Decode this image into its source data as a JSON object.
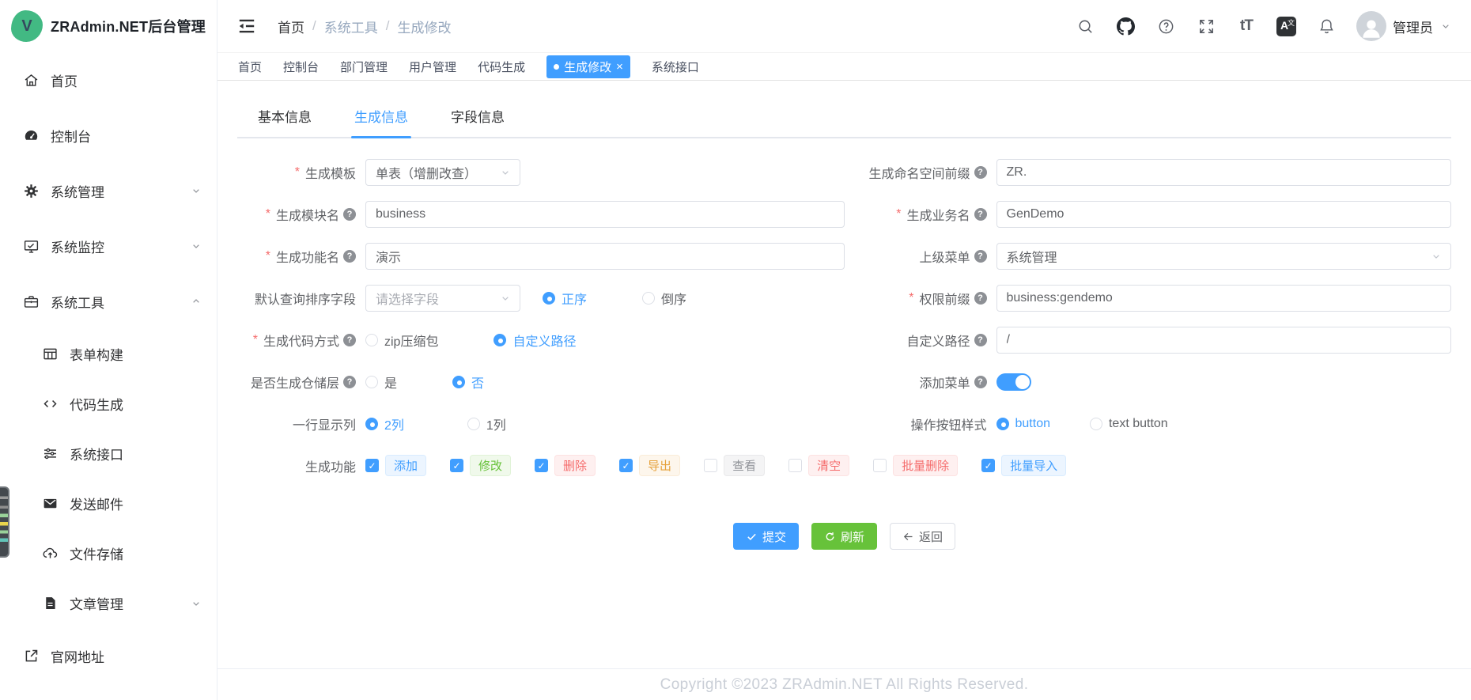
{
  "app": {
    "title": "ZRAdmin.NET后台管理",
    "logo_letter": "V"
  },
  "colors": {
    "primary": "#409eff",
    "success": "#67c23a",
    "danger": "#f56c6c",
    "warning": "#e6a23c",
    "info": "#909399",
    "logo_green": "#42b983"
  },
  "sidebar": {
    "items": [
      {
        "label": "首页",
        "icon": "home-icon"
      },
      {
        "label": "控制台",
        "icon": "dashboard-icon"
      },
      {
        "label": "系统管理",
        "icon": "gear-icon",
        "chevron": "down"
      },
      {
        "label": "系统监控",
        "icon": "monitor-icon",
        "chevron": "down"
      },
      {
        "label": "系统工具",
        "icon": "briefcase-icon",
        "chevron": "up",
        "expanded": true
      },
      {
        "label": "表单构建",
        "icon": "form-grid-icon",
        "submenu": true
      },
      {
        "label": "代码生成",
        "icon": "code-icon",
        "submenu": true
      },
      {
        "label": "系统接口",
        "icon": "sliders-icon",
        "submenu": true
      },
      {
        "label": "发送邮件",
        "icon": "mail-icon",
        "submenu": true
      },
      {
        "label": "文件存储",
        "icon": "cloud-upload-icon",
        "submenu": true
      },
      {
        "label": "文章管理",
        "icon": "document-icon",
        "submenu": true,
        "chevron": "down"
      },
      {
        "label": "官网地址",
        "icon": "external-link-icon"
      }
    ]
  },
  "header": {
    "breadcrumb": [
      "首页",
      "系统工具",
      "生成修改"
    ],
    "user_name": "管理员",
    "icons": [
      "search-icon",
      "github-icon",
      "question-icon",
      "fullscreen-icon",
      "font-size-icon",
      "language-icon",
      "bell-icon"
    ]
  },
  "tabs": [
    "首页",
    "控制台",
    "部门管理",
    "用户管理",
    "代码生成",
    "生成修改",
    "系统接口"
  ],
  "active_tab": "生成修改",
  "subtabs": [
    "基本信息",
    "生成信息",
    "字段信息"
  ],
  "active_subtab": "生成信息",
  "form": {
    "gen_template": {
      "label": "生成模板",
      "required": true,
      "value": "单表（增删改查）"
    },
    "namespace_prefix": {
      "label": "生成命名空间前缀",
      "value": "ZR."
    },
    "module_name": {
      "label": "生成模块名",
      "required": true,
      "value": "business"
    },
    "business_name": {
      "label": "生成业务名",
      "required": true,
      "value": "GenDemo"
    },
    "function_name": {
      "label": "生成功能名",
      "required": true,
      "value": "演示"
    },
    "parent_menu": {
      "label": "上级菜单",
      "value": "系统管理"
    },
    "sort_field": {
      "label": "默认查询排序字段",
      "placeholder": "请选择字段",
      "asc": "正序",
      "desc": "倒序",
      "selected": "正序"
    },
    "perm_prefix": {
      "label": "权限前缀",
      "required": true,
      "value": "business:gendemo"
    },
    "code_method": {
      "label": "生成代码方式",
      "required": true,
      "zip": "zip压缩包",
      "custom": "自定义路径",
      "selected": "自定义路径"
    },
    "custom_path": {
      "label": "自定义路径",
      "value": "/"
    },
    "repo_layer": {
      "label": "是否生成仓储层",
      "yes": "是",
      "no": "否",
      "selected": "否"
    },
    "add_menu": {
      "label": "添加菜单",
      "on": true
    },
    "columns": {
      "label": "一行显示列",
      "two": "2列",
      "one": "1列",
      "selected": "2列"
    },
    "btn_style": {
      "label": "操作按钮样式",
      "button": "button",
      "text": "text button",
      "selected": "button"
    },
    "features": {
      "label": "生成功能",
      "options": [
        {
          "label": "添加",
          "checked": true,
          "color": "primary"
        },
        {
          "label": "修改",
          "checked": true,
          "color": "success"
        },
        {
          "label": "删除",
          "checked": true,
          "color": "danger"
        },
        {
          "label": "导出",
          "checked": true,
          "color": "warning"
        },
        {
          "label": "查看",
          "checked": false,
          "color": "info"
        },
        {
          "label": "清空",
          "checked": false,
          "color": "danger"
        },
        {
          "label": "批量删除",
          "checked": false,
          "color": "danger"
        },
        {
          "label": "批量导入",
          "checked": true,
          "color": "primary"
        }
      ]
    }
  },
  "actions": {
    "submit": "提交",
    "refresh": "刷新",
    "back": "返回"
  },
  "footer": {
    "copyright": "Copyright ©2023 ZRAdmin.NET All Rights Reserved."
  }
}
